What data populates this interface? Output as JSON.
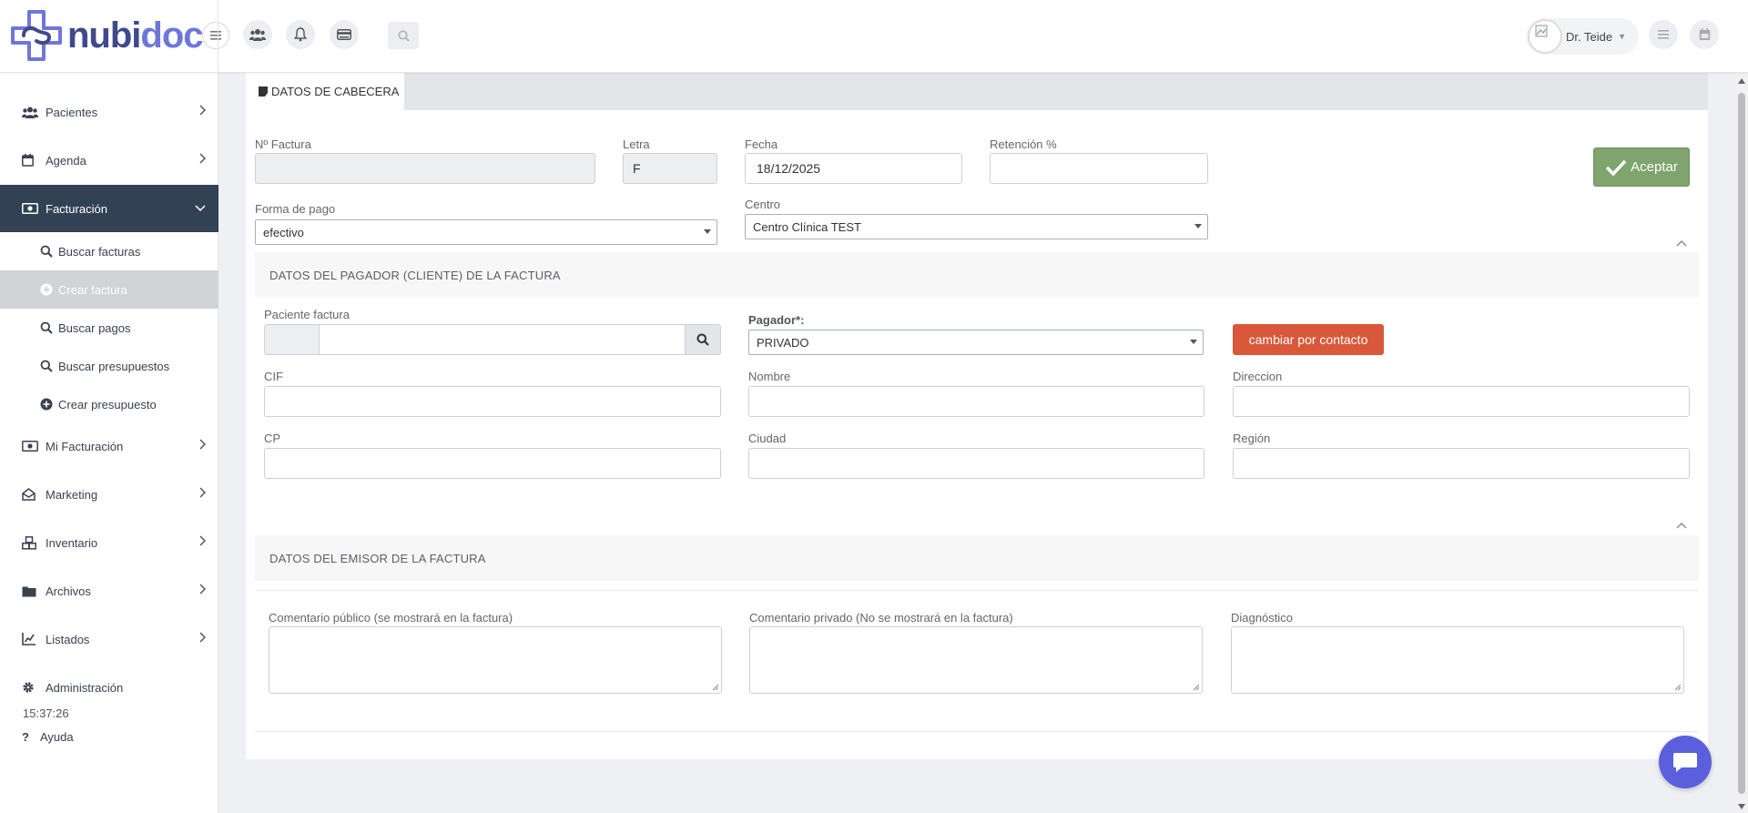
{
  "brand": {
    "logo_prefix": "nubi",
    "logo_suffix": "doc",
    "color_dark": "#3f4a8a",
    "color_light": "#6e77d9"
  },
  "header": {
    "user_name": "Dr. Teide"
  },
  "sidebar": {
    "items": [
      {
        "label": "Pacientes",
        "icon": "users-icon"
      },
      {
        "label": "Agenda",
        "icon": "calendar-icon"
      },
      {
        "label": "Facturación",
        "icon": "money-icon",
        "active": true
      },
      {
        "label": "Mi Facturación",
        "icon": "money-icon"
      },
      {
        "label": "Marketing",
        "icon": "envelope-open-icon"
      },
      {
        "label": "Inventario",
        "icon": "boxes-icon"
      },
      {
        "label": "Archivos",
        "icon": "folder-icon"
      },
      {
        "label": "Listados",
        "icon": "chart-line-icon"
      },
      {
        "label": "Administración",
        "icon": "gear-icon"
      },
      {
        "label": "Ayuda",
        "icon": "question-icon"
      }
    ],
    "sub_items": [
      {
        "label": "Buscar facturas",
        "icon": "search-icon"
      },
      {
        "label": "Crear factura",
        "icon": "plus-circle-icon",
        "active": true
      },
      {
        "label": "Buscar pagos",
        "icon": "search-icon"
      },
      {
        "label": "Buscar presupuestos",
        "icon": "search-icon"
      },
      {
        "label": "Crear presupuesto",
        "icon": "plus-circle-icon"
      }
    ],
    "clock": "15:37:26",
    "active_color": "#334155"
  },
  "main": {
    "tab_label": "DATOS DE CABECERA",
    "fields": {
      "nfactura_label": "Nº Factura",
      "nfactura_value": "",
      "letra_label": "Letra",
      "letra_value": "F",
      "fecha_label": "Fecha",
      "fecha_value": "18/12/2025",
      "retencion_label": "Retención %",
      "retencion_value": "",
      "forma_pago_label": "Forma de pago",
      "forma_pago_value": "efectivo",
      "centro_label": "Centro",
      "centro_value": "Centro Clínica TEST"
    },
    "accept_label": "Aceptar",
    "accept_color": "#7fa46e",
    "payer_section": {
      "title": "DATOS DEL PAGADOR (CLIENTE) DE LA FACTURA",
      "paciente_label": "Paciente factura",
      "pagador_label": "Pagador*:",
      "pagador_value": "PRIVADO",
      "contact_button": "cambiar por contacto",
      "contact_color": "#d9583a",
      "cif_label": "CIF",
      "nombre_label": "Nombre",
      "direccion_label": "Direccion",
      "cp_label": "CP",
      "ciudad_label": "Ciudad",
      "region_label": "Región"
    },
    "issuer_section": {
      "title": "DATOS DEL EMISOR DE LA FACTURA"
    },
    "comments": {
      "public_label": "Comentario público (se mostrará en la factura)",
      "private_label": "Comentario privado (No se mostrará en la factura)",
      "diagnostico_label": "Diagnóstico"
    }
  },
  "chat": {
    "color": "#5b5fdc"
  }
}
